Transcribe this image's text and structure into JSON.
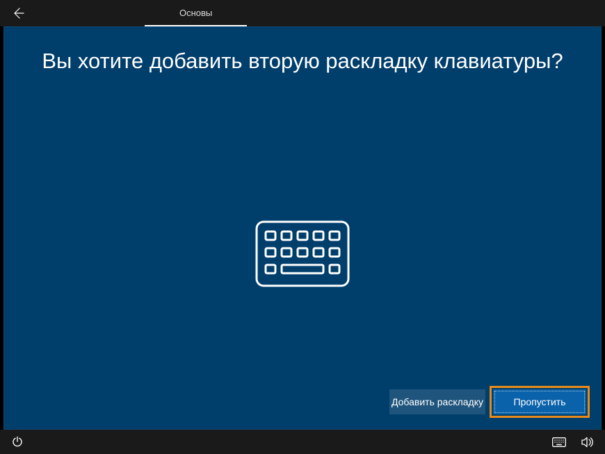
{
  "topbar": {
    "tab_label": "Основы"
  },
  "main": {
    "heading": "Вы хотите добавить вторую раскладку клавиатуры?"
  },
  "buttons": {
    "secondary": "Добавить раскладку",
    "primary": "Пропустить"
  }
}
